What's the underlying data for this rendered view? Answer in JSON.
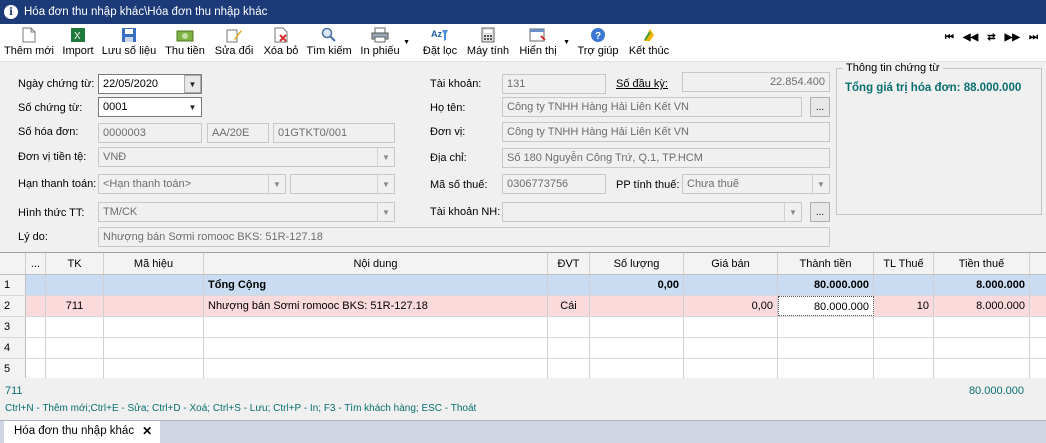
{
  "window": {
    "title": "Hóa đơn thu nhập khác\\Hóa đơn thu nhập khác",
    "title_icon": "info-icon"
  },
  "toolbar": {
    "buttons": [
      {
        "label": "Thêm mới",
        "icon": "new-document-icon"
      },
      {
        "label": "Import",
        "icon": "excel-icon"
      },
      {
        "label": "Lưu số liệu",
        "icon": "save-icon"
      },
      {
        "label": "Thu tiền",
        "icon": "money-icon"
      },
      {
        "label": "Sửa đổi",
        "icon": "edit-icon"
      },
      {
        "label": "Xóa bỏ",
        "icon": "delete-icon"
      },
      {
        "label": "Tìm kiếm",
        "icon": "search-icon"
      },
      {
        "label": "In phiếu",
        "icon": "printer-icon"
      },
      {
        "label": "Đặt lọc",
        "icon": "filter-icon"
      },
      {
        "label": "Máy tính",
        "icon": "calculator-icon"
      },
      {
        "label": "Hiển thị",
        "icon": "display-icon"
      },
      {
        "label": "Trợ giúp",
        "icon": "help-icon"
      },
      {
        "label": "Kết thúc",
        "icon": "exit-icon"
      }
    ],
    "nav": [
      "first-icon",
      "prev-icon",
      "refresh-icon",
      "next-icon",
      "last-icon"
    ]
  },
  "form": {
    "ngay_chung_tu": {
      "label": "Ngày chứng từ:",
      "value": "22/05/2020"
    },
    "so_chung_tu": {
      "label": "Số chứng từ:",
      "value": "0001"
    },
    "so_hoa_don": {
      "label": "Số hóa đơn:",
      "value": "0000003",
      "ky_hieu": "AA/20E",
      "mau_so": "01GTKT0/001"
    },
    "don_vi_tien_te": {
      "label": "Đơn vị tiền tệ:",
      "value": "VNĐ"
    },
    "han_thanh_toan": {
      "label": "Hạn thanh toán:",
      "placeholder": "<Hạn thanh toán>",
      "value2": ""
    },
    "hinh_thuc_tt": {
      "label": "Hình thức TT:",
      "value": "TM/CK"
    },
    "ly_do": {
      "label": "Lý do:",
      "value": "Nhượng bán Sơmi romooc BKS: 51R-127.18"
    },
    "tai_khoan": {
      "label": "Tài khoản:",
      "value": "131"
    },
    "so_dau_ky": {
      "label": "Số đầu kỳ:",
      "value": "22.854.400"
    },
    "ho_ten": {
      "label": "Họ tên:",
      "value": "Công ty TNHH Hàng Hải Liên Kết VN"
    },
    "don_vi": {
      "label": "Đơn vị:",
      "value": "Công ty TNHH Hàng Hải Liên Kết VN"
    },
    "dia_chi": {
      "label": "Địa chỉ:",
      "value": "Số 180 Nguyễn Công Trứ, Q.1, TP.HCM"
    },
    "ma_so_thue": {
      "label": "Mã số thuế:",
      "value": "0306773756"
    },
    "pp_tinh_thue": {
      "label": "PP tính thuế:",
      "value": "Chưa thuế"
    },
    "tai_khoan_nh": {
      "label": "Tài khoản NH:",
      "value": ""
    },
    "dots": "..."
  },
  "info": {
    "legend": "Thông tin chứng từ",
    "total": "Tổng giá trị hóa đơn: 88.000.000"
  },
  "grid": {
    "headers": [
      "",
      "...",
      "TK",
      "Mã hiệu",
      "Nội dung",
      "ĐVT",
      "Số lượng",
      "Giá bán",
      "Thành tiền",
      "TL Thuế",
      "Tiền thuế"
    ],
    "rows": [
      {
        "no": "1",
        "tk": "",
        "ma": "",
        "noi_dung": "Tổng Cộng",
        "dvt": "",
        "so_luong": "0,00",
        "gia_ban": "",
        "thanh_tien": "80.000.000",
        "tl_thue": "",
        "tien_thue": "8.000.000"
      },
      {
        "no": "2",
        "tk": "711",
        "ma": "",
        "noi_dung": "Nhượng bán Sơmi romooc BKS: 51R-127.18",
        "dvt": "Cái",
        "so_luong": "",
        "gia_ban": "0,00",
        "thanh_tien": "80.000.000",
        "tl_thue": "10",
        "tien_thue": "8.000.000"
      },
      {
        "no": "3"
      },
      {
        "no": "4"
      },
      {
        "no": "5"
      }
    ]
  },
  "footer": {
    "account": "711",
    "amount": "80.000.000",
    "shortcuts": "Ctrl+N - Thêm mới;Ctrl+E - Sửa; Ctrl+D - Xoá; Ctrl+S - Lưu; Ctrl+P - In; F3 - Tìm khách hàng; ESC - Thoát"
  },
  "tabs": [
    {
      "label": "Hóa đơn thu nhập khác",
      "close": "✕"
    }
  ]
}
